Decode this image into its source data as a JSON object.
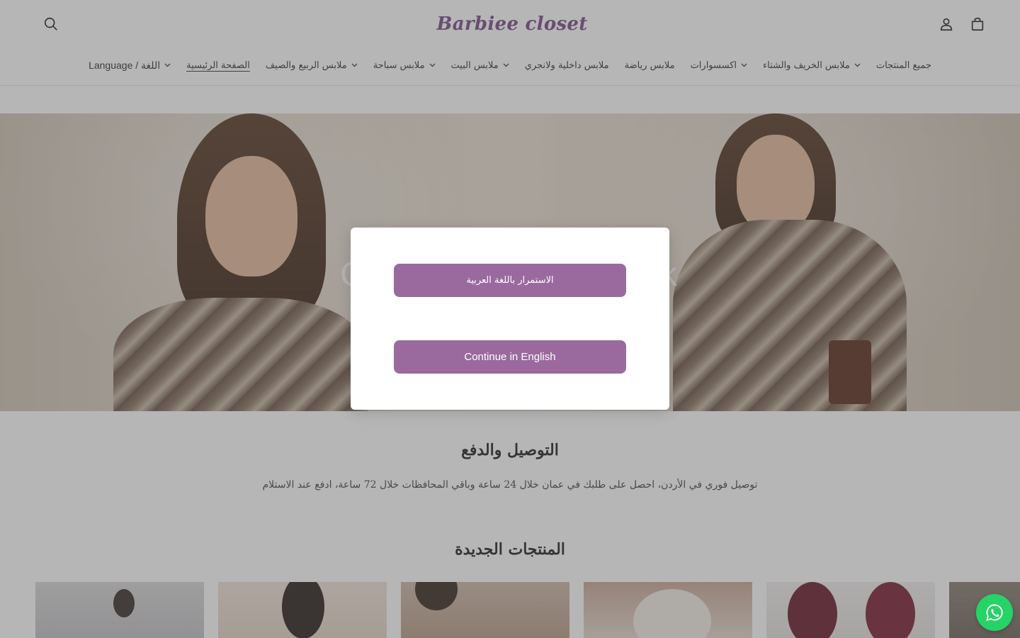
{
  "header": {
    "logo_text": "Barbiee closet",
    "icons": {
      "search": "search-icon",
      "account": "account-icon",
      "cart": "cart-icon"
    }
  },
  "nav": {
    "items": [
      {
        "label": "جميع المنتجات",
        "has_dropdown": false
      },
      {
        "label": "ملابس الخريف والشتاء",
        "has_dropdown": true
      },
      {
        "label": "اكسسوارات",
        "has_dropdown": true
      },
      {
        "label": "ملابس رياضة",
        "has_dropdown": false
      },
      {
        "label": "ملابس داخلية ولانجري",
        "has_dropdown": false
      },
      {
        "label": "ملابس البيت",
        "has_dropdown": true
      },
      {
        "label": "ملابس سباحة",
        "has_dropdown": true
      },
      {
        "label": "ملابس الربيع والصيف",
        "has_dropdown": true
      },
      {
        "label": "الصفحة الرئيسية",
        "has_dropdown": false,
        "active": true
      },
      {
        "label": "Language / اللغة",
        "has_dropdown": true
      }
    ]
  },
  "hero": {
    "left_letter": "C",
    "right_letter": "k"
  },
  "delivery": {
    "title": "التوصيل والدفع",
    "text": "توصيل فوري في الأردن، احصل على طلبك في عمان خلال 24 ساعة وباقي المحافظات خلال 72 ساعة، ادفع عند الاستلام"
  },
  "new_products": {
    "title": "المنتجات الجديدة"
  },
  "modal": {
    "arabic_button": "الاستمرار باللغة العربية",
    "english_button": "Continue in English"
  },
  "colors": {
    "accent": "#9a6a9e",
    "whatsapp": "#25d366",
    "overlay": "rgba(80,80,80,0.42)"
  },
  "floating": {
    "whatsapp_icon": "whatsapp-icon"
  }
}
